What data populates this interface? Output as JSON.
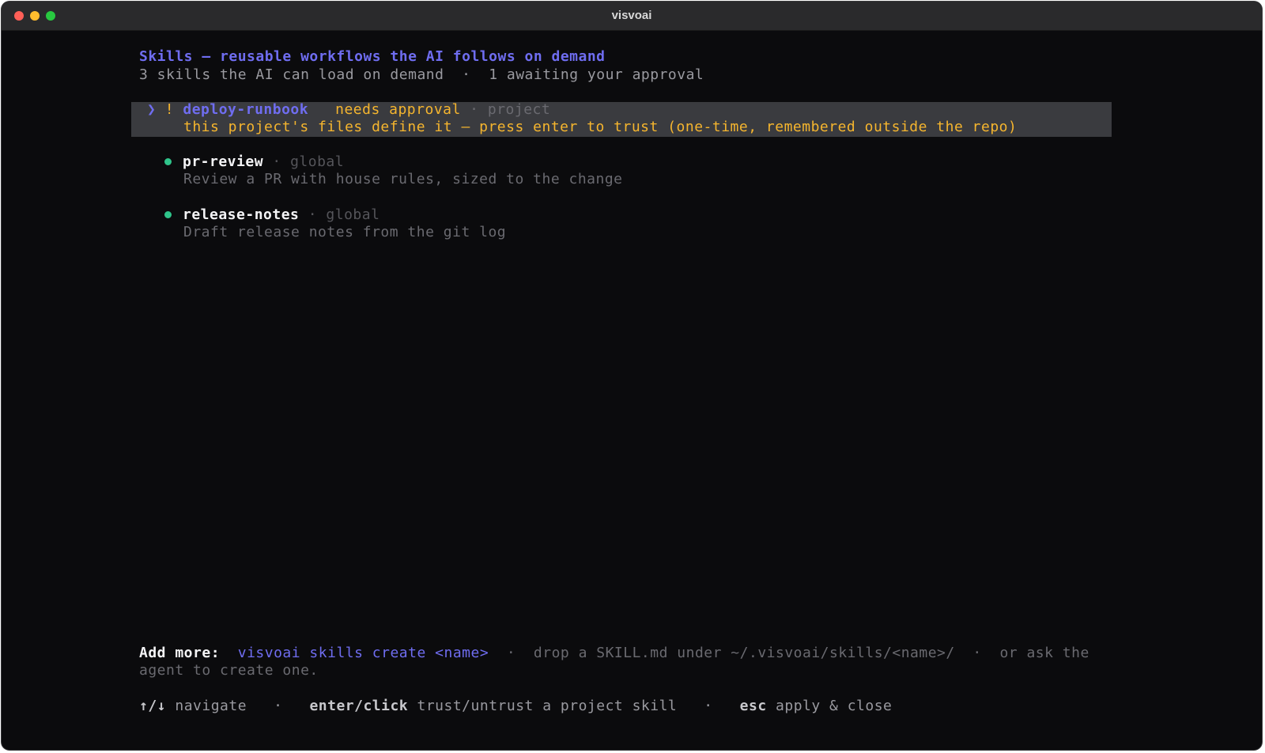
{
  "window": {
    "title": "visvoai"
  },
  "header": {
    "title": "Skills — reusable workflows the AI follows on demand",
    "summary_count": "3 skills the AI can load on demand",
    "separator": "·",
    "summary_pending": "1 awaiting your approval"
  },
  "skills": [
    {
      "marker": "❯",
      "flag": "!",
      "name": "deploy-runbook",
      "status": "needs approval",
      "separator": "·",
      "scope": "project",
      "description": "this project's files define it — press enter to trust (one-time, remembered outside the repo)",
      "selected": true
    },
    {
      "name": "pr-review",
      "separator": "·",
      "scope": "global",
      "description": "Review a PR with house rules, sized to the change",
      "status_color": "#2fc48a"
    },
    {
      "name": "release-notes",
      "separator": "·",
      "scope": "global",
      "description": "Draft release notes from the git log",
      "status_color": "#2fc48a"
    }
  ],
  "add_more": {
    "label": "Add more:",
    "command": "visvoai skills create <name>",
    "separator": "·",
    "drop_hint": "drop a SKILL.md under ~/.visvoai/skills/<name>/",
    "ask_hint_part1": "or ask the",
    "ask_hint_part2": "agent to create one."
  },
  "keybindings": [
    {
      "key": "↑/↓",
      "action": "navigate"
    },
    {
      "key": "enter/click",
      "action": "trust/untrust a project skill"
    },
    {
      "key": "esc",
      "action": "apply & close"
    }
  ],
  "keybinding_separator": "·",
  "colors": {
    "accent": "#6f6df0",
    "warning": "#f5b52e",
    "ok": "#2fc48a",
    "background": "#0b0b0d"
  }
}
